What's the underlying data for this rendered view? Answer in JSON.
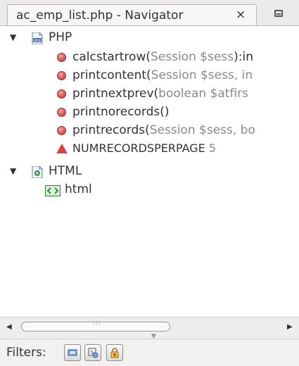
{
  "tab": {
    "title": "ac_emp_list.php - Navigator",
    "close_glyph": "×"
  },
  "tree": {
    "php_group": {
      "label": "PHP",
      "icon": "php-file-icon",
      "expanded": true,
      "functions": [
        {
          "name": "calcstartrow",
          "open": "(",
          "params": "Session $sess",
          "rest": "):in"
        },
        {
          "name": "printcontent",
          "open": "(",
          "params": "Session $sess, in",
          "rest": ""
        },
        {
          "name": "printnextprev",
          "open": "(",
          "params": "boolean $atfirs",
          "rest": ""
        },
        {
          "name": "printnorecords",
          "open": "()",
          "params": "",
          "rest": ""
        },
        {
          "name": "printrecords",
          "open": "(",
          "params": "Session $sess, bo",
          "rest": ""
        }
      ],
      "constant": {
        "name": "NUMRECORDSPERPAGE",
        "value": "5"
      }
    },
    "html_group": {
      "label": "HTML",
      "icon": "html-file-icon",
      "expanded": true,
      "children": [
        {
          "label": "html",
          "icon": "html-tag-icon"
        }
      ]
    }
  },
  "scrollbar": {
    "grip": " :::"
  },
  "filters": {
    "label": "Filters:",
    "buttons": [
      {
        "name": "filter-fields-button",
        "icon": "field-filter-icon"
      },
      {
        "name": "filter-inherited-button",
        "icon": "inherited-filter-icon"
      },
      {
        "name": "filter-private-button",
        "icon": "private-lock-icon"
      }
    ]
  },
  "colors": {
    "method": "#d65a5a",
    "constant": "#d9433f",
    "muted_text": "#8a8a8a",
    "html_icon": "#2f8f3a"
  }
}
